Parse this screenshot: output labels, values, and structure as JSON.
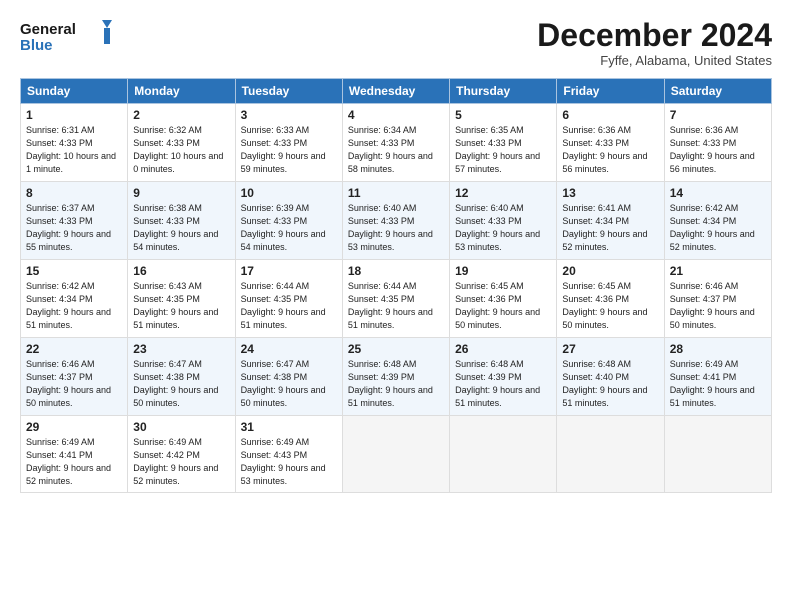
{
  "header": {
    "logo_line1": "General",
    "logo_line2": "Blue",
    "month_title": "December 2024",
    "location": "Fyffe, Alabama, United States"
  },
  "weekdays": [
    "Sunday",
    "Monday",
    "Tuesday",
    "Wednesday",
    "Thursday",
    "Friday",
    "Saturday"
  ],
  "weeks": [
    [
      {
        "day": "1",
        "sunrise": "6:31 AM",
        "sunset": "4:33 PM",
        "daylight": "10 hours and 1 minute."
      },
      {
        "day": "2",
        "sunrise": "6:32 AM",
        "sunset": "4:33 PM",
        "daylight": "10 hours and 0 minutes."
      },
      {
        "day": "3",
        "sunrise": "6:33 AM",
        "sunset": "4:33 PM",
        "daylight": "9 hours and 59 minutes."
      },
      {
        "day": "4",
        "sunrise": "6:34 AM",
        "sunset": "4:33 PM",
        "daylight": "9 hours and 58 minutes."
      },
      {
        "day": "5",
        "sunrise": "6:35 AM",
        "sunset": "4:33 PM",
        "daylight": "9 hours and 57 minutes."
      },
      {
        "day": "6",
        "sunrise": "6:36 AM",
        "sunset": "4:33 PM",
        "daylight": "9 hours and 56 minutes."
      },
      {
        "day": "7",
        "sunrise": "6:36 AM",
        "sunset": "4:33 PM",
        "daylight": "9 hours and 56 minutes."
      }
    ],
    [
      {
        "day": "8",
        "sunrise": "6:37 AM",
        "sunset": "4:33 PM",
        "daylight": "9 hours and 55 minutes."
      },
      {
        "day": "9",
        "sunrise": "6:38 AM",
        "sunset": "4:33 PM",
        "daylight": "9 hours and 54 minutes."
      },
      {
        "day": "10",
        "sunrise": "6:39 AM",
        "sunset": "4:33 PM",
        "daylight": "9 hours and 54 minutes."
      },
      {
        "day": "11",
        "sunrise": "6:40 AM",
        "sunset": "4:33 PM",
        "daylight": "9 hours and 53 minutes."
      },
      {
        "day": "12",
        "sunrise": "6:40 AM",
        "sunset": "4:33 PM",
        "daylight": "9 hours and 53 minutes."
      },
      {
        "day": "13",
        "sunrise": "6:41 AM",
        "sunset": "4:34 PM",
        "daylight": "9 hours and 52 minutes."
      },
      {
        "day": "14",
        "sunrise": "6:42 AM",
        "sunset": "4:34 PM",
        "daylight": "9 hours and 52 minutes."
      }
    ],
    [
      {
        "day": "15",
        "sunrise": "6:42 AM",
        "sunset": "4:34 PM",
        "daylight": "9 hours and 51 minutes."
      },
      {
        "day": "16",
        "sunrise": "6:43 AM",
        "sunset": "4:35 PM",
        "daylight": "9 hours and 51 minutes."
      },
      {
        "day": "17",
        "sunrise": "6:44 AM",
        "sunset": "4:35 PM",
        "daylight": "9 hours and 51 minutes."
      },
      {
        "day": "18",
        "sunrise": "6:44 AM",
        "sunset": "4:35 PM",
        "daylight": "9 hours and 51 minutes."
      },
      {
        "day": "19",
        "sunrise": "6:45 AM",
        "sunset": "4:36 PM",
        "daylight": "9 hours and 50 minutes."
      },
      {
        "day": "20",
        "sunrise": "6:45 AM",
        "sunset": "4:36 PM",
        "daylight": "9 hours and 50 minutes."
      },
      {
        "day": "21",
        "sunrise": "6:46 AM",
        "sunset": "4:37 PM",
        "daylight": "9 hours and 50 minutes."
      }
    ],
    [
      {
        "day": "22",
        "sunrise": "6:46 AM",
        "sunset": "4:37 PM",
        "daylight": "9 hours and 50 minutes."
      },
      {
        "day": "23",
        "sunrise": "6:47 AM",
        "sunset": "4:38 PM",
        "daylight": "9 hours and 50 minutes."
      },
      {
        "day": "24",
        "sunrise": "6:47 AM",
        "sunset": "4:38 PM",
        "daylight": "9 hours and 50 minutes."
      },
      {
        "day": "25",
        "sunrise": "6:48 AM",
        "sunset": "4:39 PM",
        "daylight": "9 hours and 51 minutes."
      },
      {
        "day": "26",
        "sunrise": "6:48 AM",
        "sunset": "4:39 PM",
        "daylight": "9 hours and 51 minutes."
      },
      {
        "day": "27",
        "sunrise": "6:48 AM",
        "sunset": "4:40 PM",
        "daylight": "9 hours and 51 minutes."
      },
      {
        "day": "28",
        "sunrise": "6:49 AM",
        "sunset": "4:41 PM",
        "daylight": "9 hours and 51 minutes."
      }
    ],
    [
      {
        "day": "29",
        "sunrise": "6:49 AM",
        "sunset": "4:41 PM",
        "daylight": "9 hours and 52 minutes."
      },
      {
        "day": "30",
        "sunrise": "6:49 AM",
        "sunset": "4:42 PM",
        "daylight": "9 hours and 52 minutes."
      },
      {
        "day": "31",
        "sunrise": "6:49 AM",
        "sunset": "4:43 PM",
        "daylight": "9 hours and 53 minutes."
      },
      null,
      null,
      null,
      null
    ]
  ]
}
